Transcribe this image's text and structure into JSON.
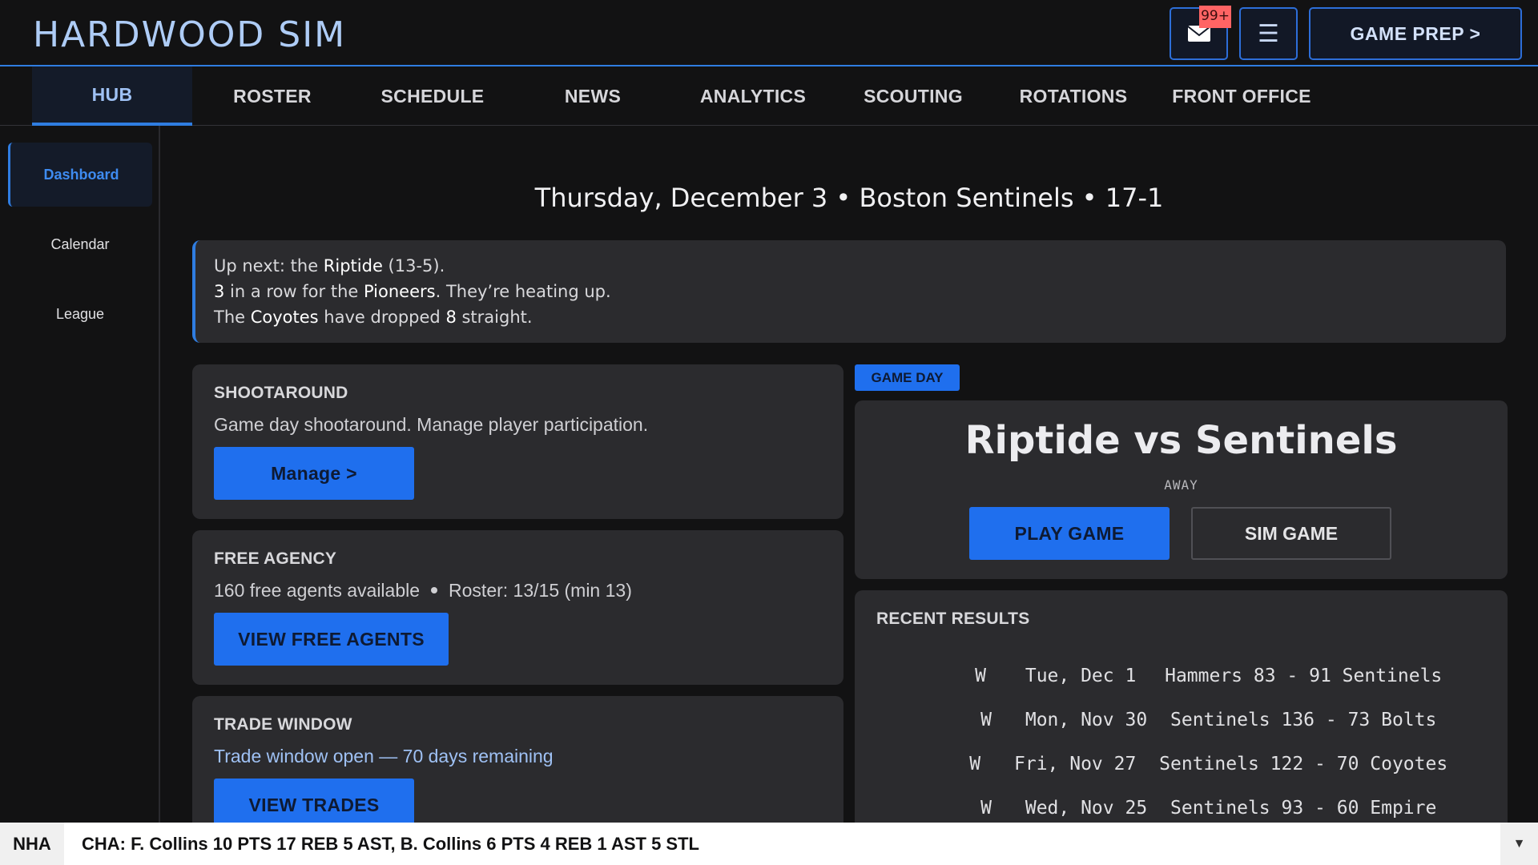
{
  "app": {
    "brand": "HARDWOOD SIM",
    "mail_badge": "99+",
    "menu_glyph": "☰",
    "game_prep_label": "GAME PREP >"
  },
  "nav": {
    "tabs": [
      {
        "label": "HUB",
        "active": true
      },
      {
        "label": "ROSTER"
      },
      {
        "label": "SCHEDULE"
      },
      {
        "label": "NEWS"
      },
      {
        "label": "ANALYTICS"
      },
      {
        "label": "SCOUTING"
      },
      {
        "label": "ROTATIONS"
      },
      {
        "label": "FRONT OFFICE"
      }
    ]
  },
  "sidebar": {
    "items": [
      {
        "label": "Dashboard",
        "active": true
      },
      {
        "label": "Calendar"
      },
      {
        "label": "League"
      }
    ]
  },
  "header": {
    "date_line": "Thursday, December 3  •  Boston Sentinels  •  17-1"
  },
  "news": {
    "line1_a": "Up next: the ",
    "line1_team": "Riptide",
    "line1_b": " (13-5).",
    "line2_num": "3",
    "line2_a": " in a row for the ",
    "line2_team": "Pioneers",
    "line2_b": ". They’re heating up.",
    "line3_a": "The ",
    "line3_team": "Coyotes",
    "line3_b": " have dropped ",
    "line3_num": "8",
    "line3_c": " straight."
  },
  "shootaround": {
    "title": "SHOOTAROUND",
    "text": "Game day shootaround. Manage player participation.",
    "button": "Manage >"
  },
  "free_agency": {
    "title": "FREE AGENCY",
    "available": "160 free agents available",
    "roster": "Roster: 13/15 (min 13)",
    "button": "VIEW FREE AGENTS"
  },
  "trade_window": {
    "title": "TRADE WINDOW",
    "text": "Trade window open — 70 days remaining",
    "button": "VIEW TRADES"
  },
  "game_day": {
    "pill": "GAME DAY",
    "matchup": "Riptide vs Sentinels",
    "location": "AWAY",
    "play_button": "PLAY GAME",
    "sim_button": "SIM GAME"
  },
  "recent_results": {
    "title": "RECENT RESULTS",
    "rows": [
      {
        "result": "W",
        "date": "Tue, Dec 1",
        "score": "Hammers 83 - 91 Sentinels"
      },
      {
        "result": "W",
        "date": "Mon, Nov 30",
        "score": "Sentinels 136 - 73 Bolts"
      },
      {
        "result": "W",
        "date": "Fri, Nov 27",
        "score": "Sentinels 122 - 70 Coyotes"
      },
      {
        "result": "W",
        "date": "Wed, Nov 25",
        "score": "Sentinels 93 - 60 Empire"
      }
    ]
  },
  "ticker": {
    "league": "NHA",
    "text": "CHA: F. Collins 10 PTS 17 REB 5 AST, B. Collins 6 PTS 4 REB 1 AST 5 STL",
    "toggle": "▼"
  },
  "colors": {
    "accent": "#1f6fee",
    "brand": "#aeccf6",
    "badge": "#ff6464",
    "panel": "#2b2b2e",
    "background": "#121213"
  }
}
